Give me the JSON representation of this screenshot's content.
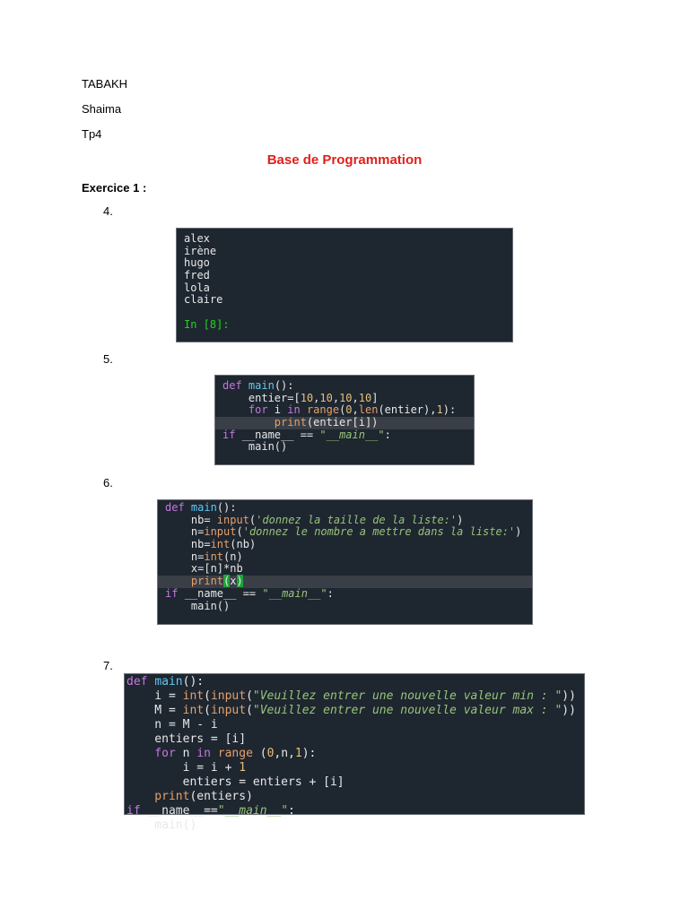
{
  "header": {
    "name": "TABAKH",
    "firstname": "Shaima",
    "tp": "Tp4"
  },
  "title": "Base de Programmation",
  "section": "Exercice 1 :",
  "items": [
    "4.",
    "5.",
    "6.",
    "7."
  ],
  "colors": {
    "title": "#e0201c",
    "code_bg": "#1e2630"
  },
  "blocks": {
    "b4": [
      [
        [
          "op",
          "alex"
        ]
      ],
      [
        [
          "op",
          "irène"
        ]
      ],
      [
        [
          "op",
          "hugo"
        ]
      ],
      [
        [
          "op",
          "fred"
        ]
      ],
      [
        [
          "op",
          "lola"
        ]
      ],
      [
        [
          "op",
          "claire"
        ]
      ],
      [
        [
          "op",
          ""
        ]
      ],
      [
        [
          "pr",
          "In [8]:"
        ]
      ]
    ],
    "b5": [
      [
        [
          "kw",
          "def "
        ],
        [
          "fn",
          "main"
        ],
        [
          "op",
          "():"
        ]
      ],
      [
        [
          "op",
          "    entier=["
        ],
        [
          "nu",
          "10"
        ],
        [
          "op",
          ","
        ],
        [
          "nu",
          "10"
        ],
        [
          "op",
          ","
        ],
        [
          "nu",
          "10"
        ],
        [
          "op",
          ","
        ],
        [
          "nu",
          "10"
        ],
        [
          "op",
          "]"
        ]
      ],
      [
        [
          "kw",
          "    for "
        ],
        [
          "op",
          "i "
        ],
        [
          "kw",
          "in "
        ],
        [
          "bi",
          "range"
        ],
        [
          "op",
          "("
        ],
        [
          "nu",
          "0"
        ],
        [
          "op",
          ","
        ],
        [
          "bi",
          "len"
        ],
        [
          "op",
          "(entier),"
        ],
        [
          "nu",
          "1"
        ],
        [
          "op",
          "):"
        ]
      ],
      [
        [
          "bi",
          "        print"
        ],
        [
          "op",
          "(entier[i])"
        ]
      ],
      [
        [
          "kw",
          "if "
        ],
        [
          "op",
          "__name__ == "
        ],
        [
          "st",
          "\"__main__\""
        ],
        [
          "op",
          ":"
        ]
      ],
      [
        [
          "op",
          "    main()"
        ]
      ]
    ],
    "b6": [
      [
        [
          "kw",
          "def "
        ],
        [
          "fn",
          "main"
        ],
        [
          "op",
          "():"
        ]
      ],
      [
        [
          "op",
          "    nb= "
        ],
        [
          "bi",
          "input"
        ],
        [
          "op",
          "("
        ],
        [
          "st",
          "'donnez la taille de la liste:'"
        ],
        [
          "op",
          ")"
        ]
      ],
      [
        [
          "op",
          "    n="
        ],
        [
          "bi",
          "input"
        ],
        [
          "op",
          "("
        ],
        [
          "st",
          "'donnez le nombre a mettre dans la liste:'"
        ],
        [
          "op",
          ")"
        ]
      ],
      [
        [
          "op",
          "    nb="
        ],
        [
          "bi",
          "int"
        ],
        [
          "op",
          "(nb)"
        ]
      ],
      [
        [
          "op",
          "    n="
        ],
        [
          "bi",
          "int"
        ],
        [
          "op",
          "(n)"
        ]
      ],
      [
        [
          "op",
          "    x=[n]*nb"
        ]
      ],
      [
        [
          "bi",
          "    print"
        ],
        [
          "br",
          "("
        ],
        [
          "op",
          "x"
        ],
        [
          "br",
          ")"
        ]
      ],
      [
        [
          "kw",
          "if "
        ],
        [
          "op",
          "__name__ == "
        ],
        [
          "st",
          "\"__main__\""
        ],
        [
          "op",
          ":"
        ]
      ],
      [
        [
          "op",
          "    main()"
        ]
      ]
    ],
    "b7": [
      [
        [
          "kw",
          "def "
        ],
        [
          "fn",
          "main"
        ],
        [
          "op",
          "():"
        ]
      ],
      [
        [
          "op",
          "    i = "
        ],
        [
          "bi",
          "int"
        ],
        [
          "op",
          "("
        ],
        [
          "bi",
          "input"
        ],
        [
          "op",
          "("
        ],
        [
          "st",
          "\"Veuillez entrer une nouvelle valeur min : \""
        ],
        [
          "op",
          "))"
        ]
      ],
      [
        [
          "op",
          "    M = "
        ],
        [
          "bi",
          "int"
        ],
        [
          "op",
          "("
        ],
        [
          "bi",
          "input"
        ],
        [
          "op",
          "("
        ],
        [
          "st",
          "\"Veuillez entrer une nouvelle valeur max : \""
        ],
        [
          "op",
          "))"
        ]
      ],
      [
        [
          "op",
          "    n = M - i"
        ]
      ],
      [
        [
          "op",
          "    entiers = [i]"
        ]
      ],
      [
        [
          "kw",
          "    for "
        ],
        [
          "op",
          "n "
        ],
        [
          "kw",
          "in "
        ],
        [
          "bi",
          "range"
        ],
        [
          "op",
          " ("
        ],
        [
          "nu",
          "0"
        ],
        [
          "op",
          ",n,"
        ],
        [
          "nu",
          "1"
        ],
        [
          "op",
          "):"
        ]
      ],
      [
        [
          "op",
          "        i = i + "
        ],
        [
          "nu",
          "1"
        ]
      ],
      [
        [
          "op",
          "        entiers = entiers + [i]"
        ]
      ],
      [
        [
          "bi",
          "    print"
        ],
        [
          "op",
          "(entiers)"
        ]
      ],
      [
        [
          "kw",
          "if "
        ],
        [
          "op",
          "__name__=="
        ],
        [
          "st",
          "\"__main__\""
        ],
        [
          "op",
          ":"
        ]
      ],
      [
        [
          "op",
          "    main()"
        ]
      ]
    ]
  }
}
